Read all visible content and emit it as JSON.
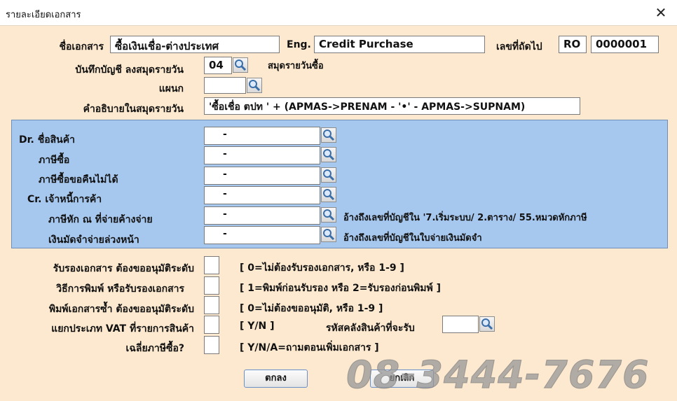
{
  "window": {
    "title": "รายละเอียดเอกสาร",
    "close_symbol": "✕"
  },
  "header": {
    "doc_name_label": "ชื่อเอกสาร",
    "doc_name_value": "ซื้อเงินเชื่อ-ต่างประเทศ",
    "eng_label": "Eng.",
    "eng_value": "Credit Purchase",
    "next_no_label": "เลขที่ถัดไป",
    "prefix_value": "RO",
    "next_no_value": "0000001",
    "journal_label": "บันทึกบัญชี ลงสมุดรายวัน",
    "journal_code": "04",
    "journal_name": "สมุดรายวันซื้อ",
    "dept_label": "แผนก",
    "dept_value": "",
    "desc_label": "คำอธิบายในสมุดรายวัน",
    "desc_value": "'ซื้อเชื่อ ตปท ' + (APMAS->PRENAM - '•' - APMAS->SUPNAM)"
  },
  "accounts": {
    "dr_product_label": "Dr. ชื่อสินค้า",
    "dr_product_value": "-",
    "purchase_tax_label": "ภาษีซื้อ",
    "purchase_tax_value": "-",
    "purchase_tax_nonrefund_label": "ภาษีซื้อขอคืนไม่ได้",
    "purchase_tax_nonrefund_value": "-",
    "cr_creditor_label": "Cr. เจ้าหนี้การค้า",
    "cr_creditor_value": "-",
    "wht_label": "ภาษีหัก ณ ที่จ่ายค้างจ่าย",
    "wht_value": "-",
    "wht_note": "อ้างถึงเลขที่บัญชีใน '7.เริ่มระบบ/ 2.ตาราง/ 55.หมวดหักภาษี",
    "deposit_label": "เงินมัดจำจ่ายล่วงหน้า",
    "deposit_value": "-",
    "deposit_note": "อ้างถึงเลขที่บัญชีในใบจ่ายเงินมัดจำ"
  },
  "settings": {
    "approve_label": "รับรองเอกสาร ต้องขออนุมัติระดับ",
    "approve_hint": "[ 0=ไม่ต้องรับรองเอกสาร,  หรือ 1-9 ]",
    "print_method_label": "วิธีการพิมพ์ หรือรับรองเอกสาร",
    "print_method_hint": "[ 1=พิมพ์ก่อนรับรอง  หรือ 2=รับรองก่อนพิมพ์ ]",
    "reprint_label": "พิมพ์เอกสารซ้ำ ต้องขออนุมัติระดับ",
    "reprint_hint": "[ 0=ไม่ต้องขออนุมัติ,  หรือ 1-9 ]",
    "vat_label": "แยกประเภท VAT ที่รายการสินค้า",
    "vat_hint": "[ Y/N ]",
    "warehouse_label": "รหัสคลังสินค้าที่จะรับ",
    "avg_tax_label": "เฉลี่ยภาษีซื้อ?",
    "avg_tax_hint": "[ Y/N/A=ถามตอนเพิ่มเอกสาร ]"
  },
  "buttons": {
    "ok": "ตกลง",
    "cancel": "ยกเลิก"
  },
  "watermark": "08-3444-7676",
  "colors": {
    "background": "#fde9cf",
    "panel": "#a7c8ee",
    "button_border": "#6a8fc8"
  }
}
